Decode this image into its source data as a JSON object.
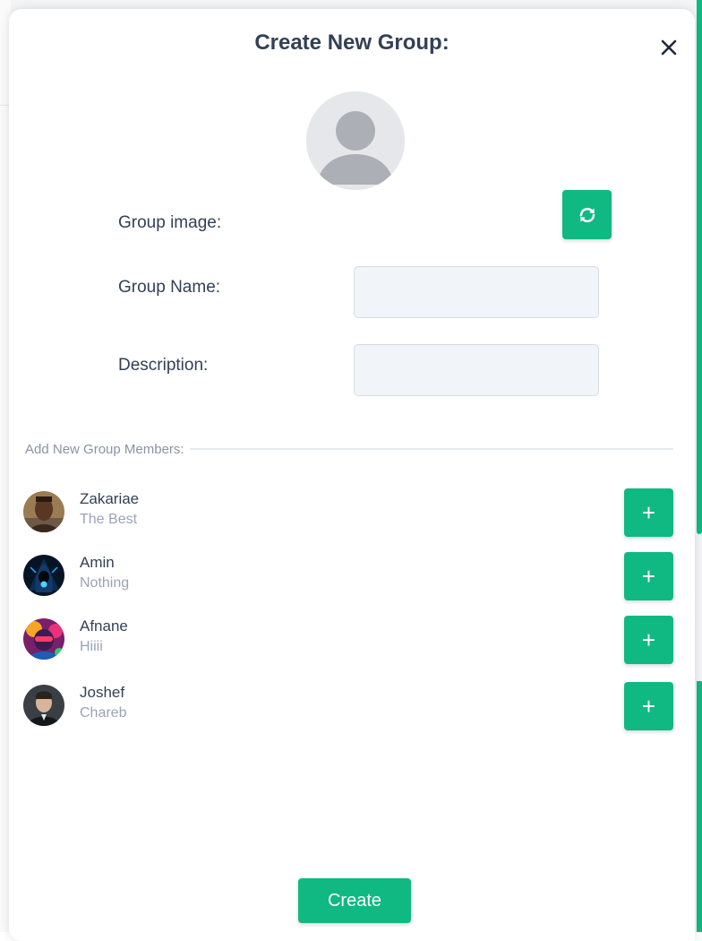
{
  "modal": {
    "title": "Create New Group:",
    "close_icon": "close-icon"
  },
  "form": {
    "group_image_label": "Group image:",
    "group_name_label": "Group Name:",
    "group_name_value": "",
    "description_label": "Description:",
    "description_value": "",
    "refresh_icon": "refresh-icon"
  },
  "members_section": {
    "title": "Add New Group Members:",
    "add_icon": "+",
    "members": [
      {
        "name": "Zakariae",
        "status": "The Best"
      },
      {
        "name": "Amin",
        "status": "Nothing"
      },
      {
        "name": "Afnane",
        "status": "Hiiii"
      },
      {
        "name": "Joshef",
        "status": "Chareb"
      }
    ]
  },
  "footer": {
    "create_label": "Create"
  },
  "colors": {
    "accent": "#10b981",
    "title_text": "#334155",
    "muted_text": "#9aa3b5",
    "input_bg": "#f1f4f8"
  }
}
